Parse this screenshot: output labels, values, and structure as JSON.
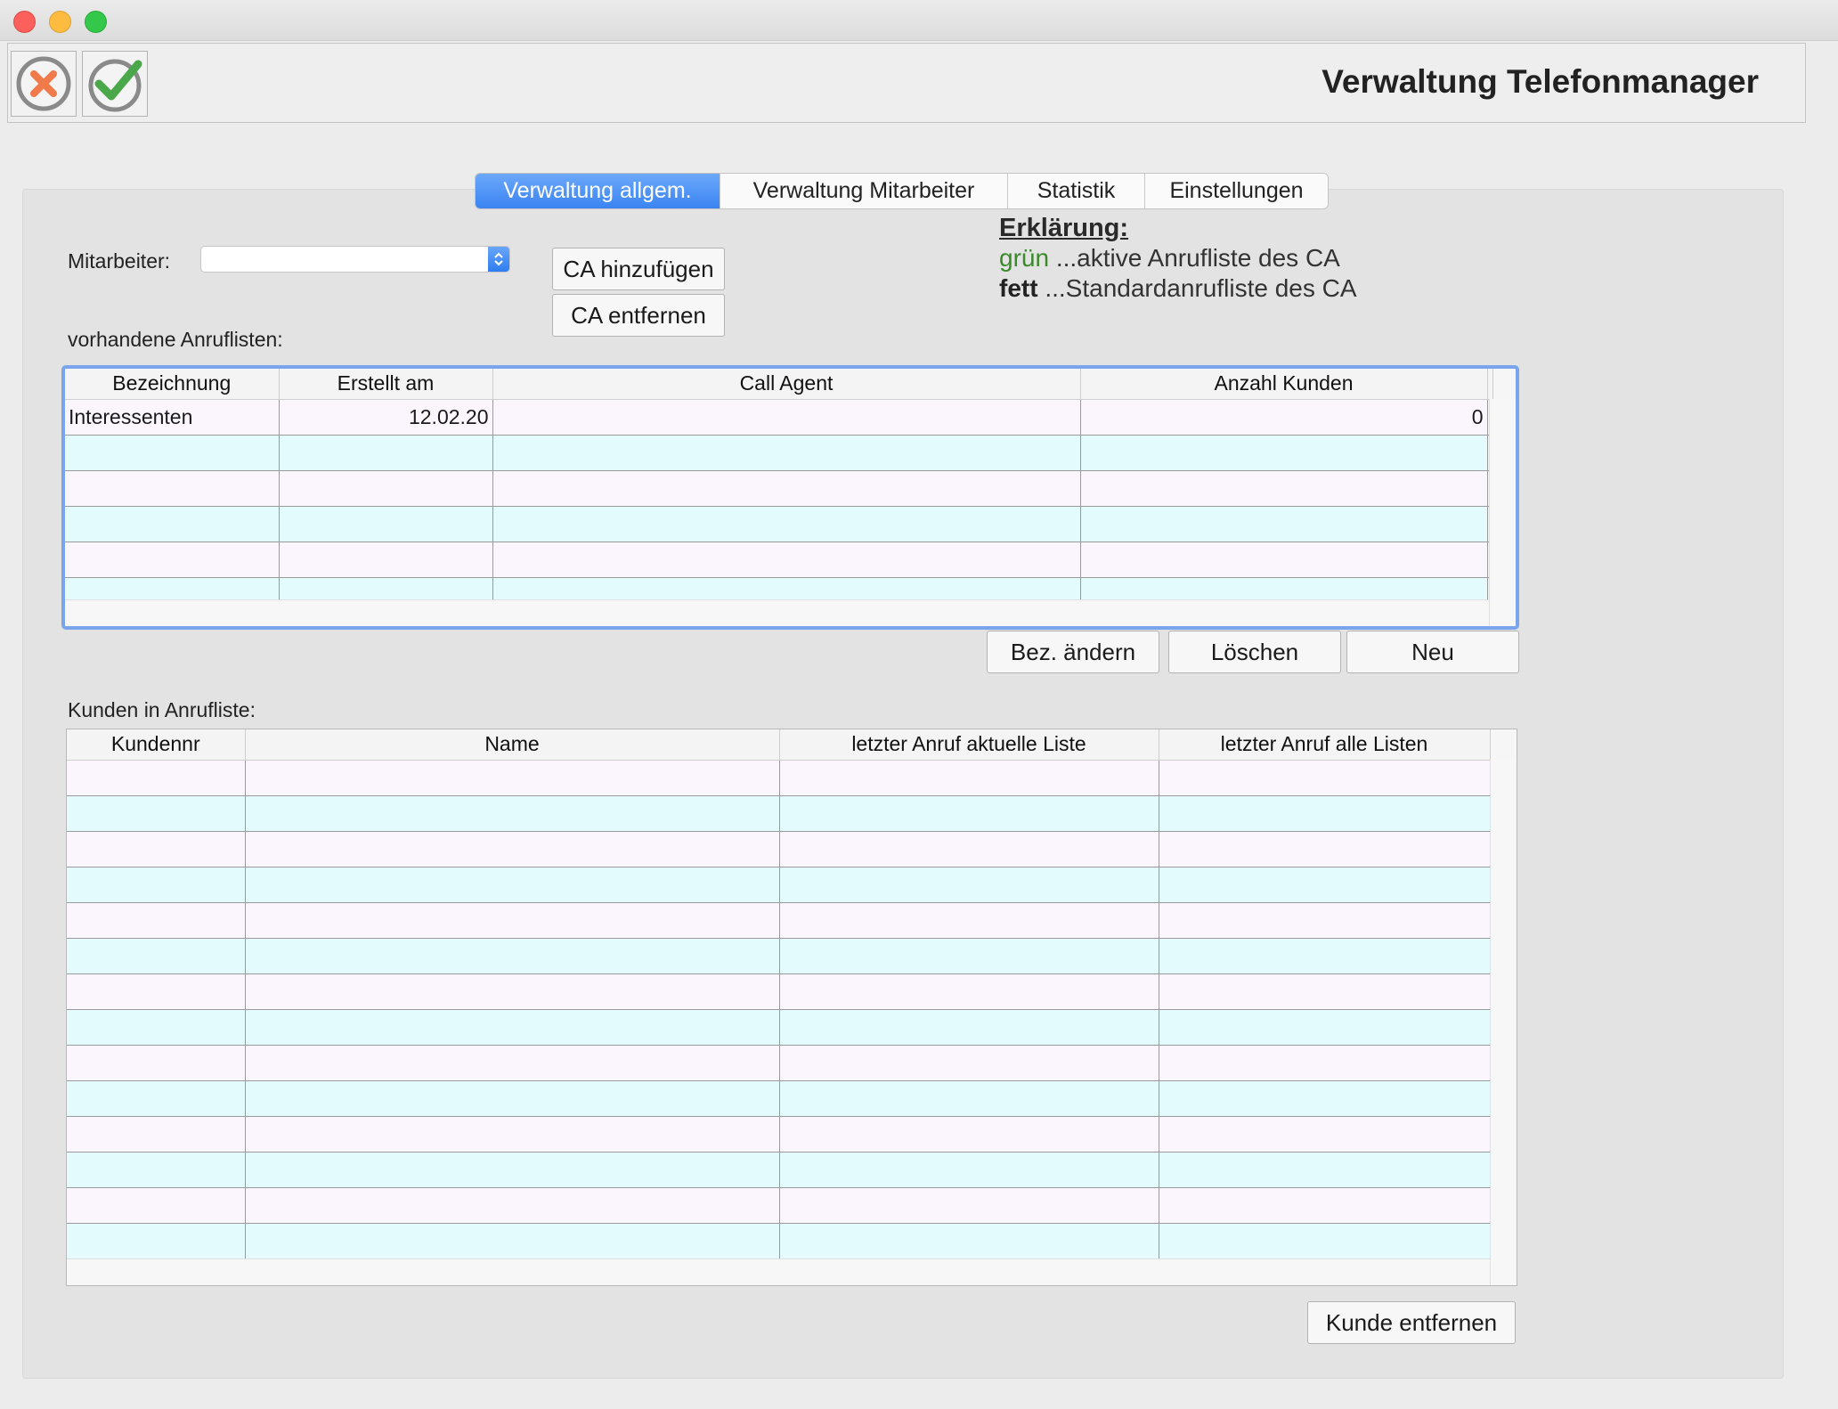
{
  "window": {
    "title": "Verwaltung Telefonmanager"
  },
  "toolbar": {
    "cancel_icon": "cancel-icon",
    "confirm_icon": "checkmark-icon"
  },
  "tabs": [
    {
      "label": "Verwaltung allgem.",
      "active": true
    },
    {
      "label": "Verwaltung Mitarbeiter",
      "active": false
    },
    {
      "label": "Statistik",
      "active": false
    },
    {
      "label": "Einstellungen",
      "active": false
    }
  ],
  "mitarbeiter": {
    "label": "Mitarbeiter:",
    "value": ""
  },
  "buttons": {
    "ca_add": "CA hinzufügen",
    "ca_remove": "CA entfernen",
    "rename": "Bez. ändern",
    "delete": "Löschen",
    "new": "Neu",
    "remove_customer": "Kunde entfernen"
  },
  "legend": {
    "title": "Erklärung:",
    "green_word": "grün",
    "green_text": "...aktive Anrufliste des CA",
    "bold_word": "fett",
    "bold_text": "...Standardanrufliste des CA"
  },
  "call_lists": {
    "label": "vorhandene Anruflisten:",
    "columns": [
      "Bezeichnung",
      "Erstellt am",
      "Call Agent",
      "Anzahl Kunden"
    ],
    "rows": [
      [
        "Interessenten",
        "12.02.20",
        "",
        "0"
      ],
      [
        "",
        "",
        "",
        ""
      ],
      [
        "",
        "",
        "",
        ""
      ],
      [
        "",
        "",
        "",
        ""
      ],
      [
        "",
        "",
        "",
        ""
      ],
      [
        "",
        "",
        "",
        ""
      ]
    ]
  },
  "customers": {
    "label": "Kunden in Anrufliste:",
    "columns": [
      "Kundennr",
      "Name",
      "letzter Anruf aktuelle Liste",
      "letzter Anruf alle Listen"
    ],
    "rows": [
      [
        "",
        "",
        "",
        ""
      ],
      [
        "",
        "",
        "",
        ""
      ],
      [
        "",
        "",
        "",
        ""
      ],
      [
        "",
        "",
        "",
        ""
      ],
      [
        "",
        "",
        "",
        ""
      ],
      [
        "",
        "",
        "",
        ""
      ],
      [
        "",
        "",
        "",
        ""
      ],
      [
        "",
        "",
        "",
        ""
      ],
      [
        "",
        "",
        "",
        ""
      ],
      [
        "",
        "",
        "",
        ""
      ],
      [
        "",
        "",
        "",
        ""
      ],
      [
        "",
        "",
        "",
        ""
      ],
      [
        "",
        "",
        "",
        ""
      ],
      [
        "",
        "",
        "",
        ""
      ]
    ]
  },
  "colors": {
    "accent": "#3a84f2",
    "row_odd": "#fbf5fd",
    "row_even": "#e3fbfc",
    "legend_green": "#3a8a2a"
  }
}
